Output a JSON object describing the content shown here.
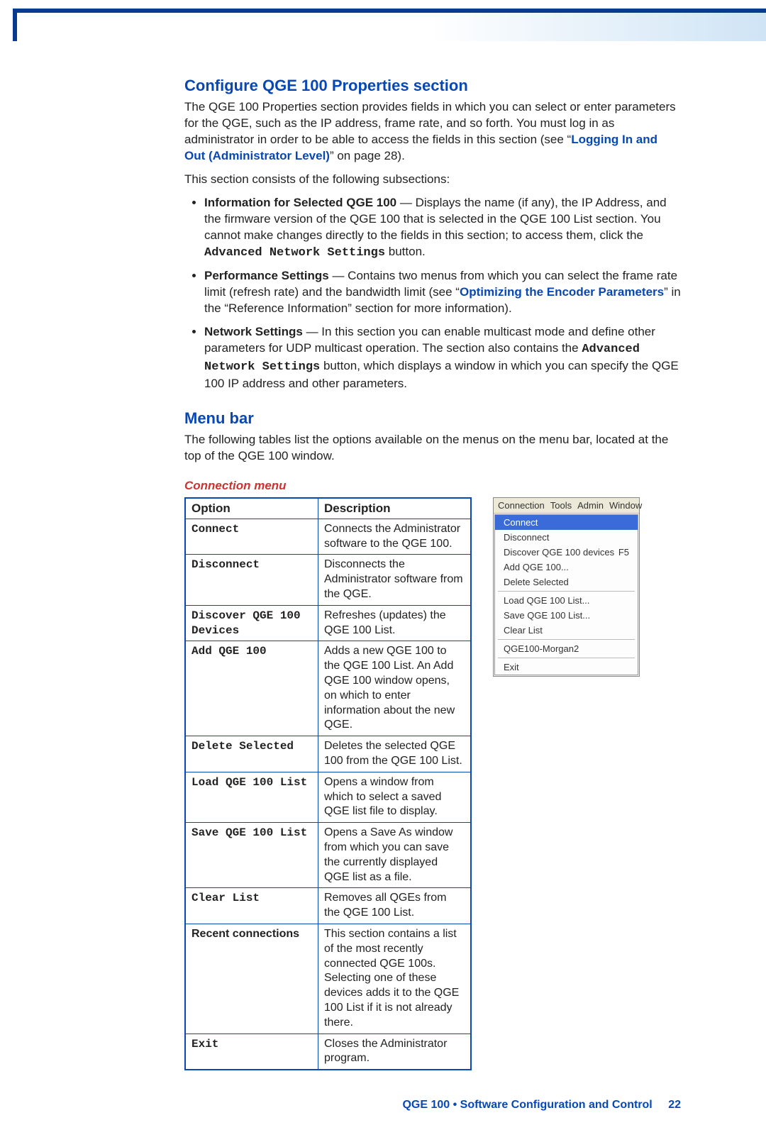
{
  "headings": {
    "h1": "Configure QGE 100 Properties section",
    "h2": "Menu bar",
    "h3": "Connection menu"
  },
  "paragraphs": {
    "p1a": "The QGE 100 Properties section provides fields in which you can select or enter parameters for the QGE, such as the IP address, frame rate, and so forth. You must log in as administrator in order to be able to access the fields in this section (see “",
    "p1_link": "Logging In and Out (Administrator Level)",
    "p1b": "” on page 28).",
    "p2": "This section consists of the following subsections:",
    "p3": "The following tables list the options available on the menus on the menu bar, located at the top of the QGE 100 window."
  },
  "bullets": {
    "b1_bold": "Information for Selected QGE 100",
    "b1_a": " — Displays the name (if any), the IP Address, and the firmware version of the QGE 100 that is selected in the QGE 100 List section. You cannot make changes directly to the fields in this section; to access them, click the ",
    "b1_mono": "Advanced Network Settings",
    "b1_b": " button.",
    "b2_bold": "Performance Settings",
    "b2_a": " — Contains two menus from which you can select the frame rate limit (refresh rate) and the bandwidth limit (see “",
    "b2_link": "Optimizing the Encoder Parameters",
    "b2_b": "” in the “Reference Information” section for more information).",
    "b3_bold": "Network Settings",
    "b3_a": " — In this section you can enable multicast mode and define other parameters for UDP multicast operation. The section also contains the ",
    "b3_mono": "Advanced Network Settings",
    "b3_b": " button, which displays a window in which you can specify the QGE 100 IP address and other parameters."
  },
  "table": {
    "head_option": "Option",
    "head_desc": "Description",
    "rows": [
      {
        "opt": "Connect",
        "mono": true,
        "desc": "Connects the Administrator software to the QGE 100."
      },
      {
        "opt": "Disconnect",
        "mono": true,
        "desc": "Disconnects the Administrator software from the QGE."
      },
      {
        "opt": "Discover QGE 100 Devices",
        "mono": true,
        "desc": "Refreshes (updates) the QGE 100 List."
      },
      {
        "opt": "Add QGE 100",
        "mono": true,
        "desc": "Adds a new QGE 100 to the QGE 100 List. An Add QGE 100 window opens, on which to enter information about the new QGE."
      },
      {
        "opt": "Delete Selected",
        "mono": true,
        "desc": "Deletes the selected QGE 100 from the QGE 100 List."
      },
      {
        "opt": "Load QGE 100 List",
        "mono": true,
        "desc": "Opens a window from which to select a saved QGE list file to display."
      },
      {
        "opt": "Save QGE 100 List",
        "mono": true,
        "desc": "Opens a Save As window from which you can save the currently displayed QGE list as a file."
      },
      {
        "opt": "Clear List",
        "mono": true,
        "desc": "Removes all QGEs from the QGE 100 List."
      },
      {
        "opt": "Recent connections",
        "mono": false,
        "desc": "This section contains a list of the most recently connected QGE 100s. Selecting one of these devices adds it to the QGE 100 List if it is not already there."
      },
      {
        "opt": "Exit",
        "mono": true,
        "desc": "Closes the Administrator program."
      }
    ]
  },
  "menu": {
    "bar": [
      "Connection",
      "Tools",
      "Admin",
      "Window"
    ],
    "items": [
      {
        "label": "Connect",
        "selected": true
      },
      {
        "label": "Disconnect"
      },
      {
        "label": "Discover QGE 100 devices",
        "hint": "F5"
      },
      {
        "label": "Add QGE 100..."
      },
      {
        "label": "Delete Selected"
      },
      {
        "sep": true
      },
      {
        "label": "Load QGE 100 List..."
      },
      {
        "label": "Save QGE 100 List..."
      },
      {
        "label": "Clear List"
      },
      {
        "sep": true
      },
      {
        "label": "QGE100-Morgan2"
      },
      {
        "sep": true
      },
      {
        "label": "Exit"
      }
    ]
  },
  "footer": {
    "text": "QGE 100 • Software Configuration and Control",
    "page": "22"
  }
}
